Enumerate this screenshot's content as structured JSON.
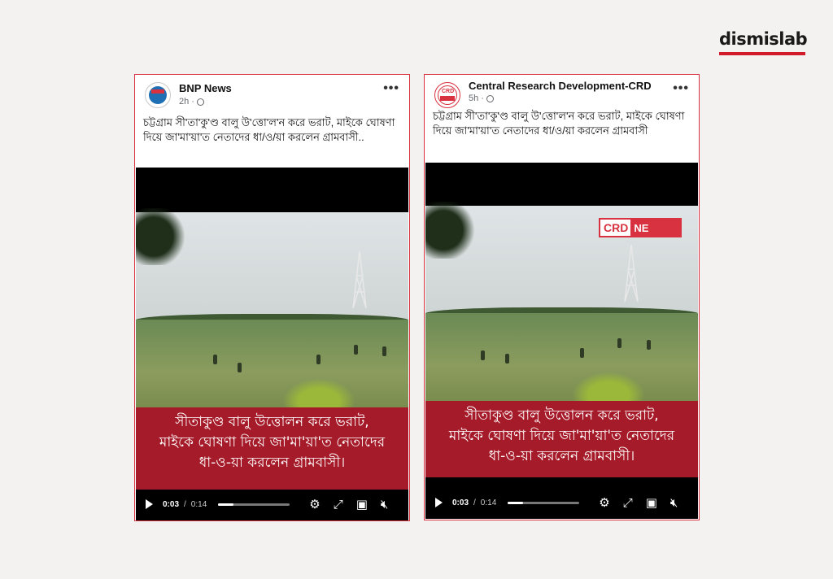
{
  "brand": {
    "name": "dismislab",
    "accent": "#d11a2a"
  },
  "posts": [
    {
      "page_name": "BNP News",
      "time": "2h",
      "meta_separator": "·",
      "more": "•••",
      "caption": "চট্টগ্রাম সী'তা'কু'ণ্ড বালু উ'ত্তো'ল'ন করে ভরাট, মাইকে ঘোষণা দিয়ে জা'মা'য়া'ত নেতাদের ধা/ও/য়া করলেন গ্রামবাসী..",
      "subtitle_lines": [
        "সীতাকুণ্ড বালু উত্তোলন করে ভরাট,",
        "মাইকে ঘোষণা দিয়ে জা'মা'য়া'ত নেতাদের",
        "ধা-ও-য়া করলেন গ্রামবাসী।"
      ],
      "time_current": "0:03",
      "time_sep": "/",
      "time_total": "0:14",
      "progress": 0.21
    },
    {
      "page_name": "Central Research Development-CRD",
      "time": "5h",
      "meta_separator": "·",
      "more": "•••",
      "avatar_text": "CRD",
      "caption": "চট্টগ্রাম সী'তা'কু'ণ্ড বালু উ'ত্তো'ল'ন করে ভরাট, মাইকে ঘোষণা দিয়ে জা'মা'য়া'ত নেতাদের ধা/ও/য়া করলেন গ্রামবাসী",
      "overlay_logo_a": "CRD",
      "overlay_logo_b": "NE",
      "subtitle_lines": [
        "সীতাকুণ্ড বালু উত্তোলন করে ভরাট,",
        "মাইকে ঘোষণা দিয়ে জা'মা'য়া'ত নেতাদের",
        "ধা-ও-য়া করলেন গ্রামবাসী।"
      ],
      "time_current": "0:03",
      "time_sep": "/",
      "time_total": "0:14",
      "progress": 0.21
    }
  ],
  "icons": [
    "play-icon",
    "settings-gear-icon",
    "fullscreen-expand-icon",
    "picture-in-picture-icon",
    "volume-muted-icon",
    "globe-icon",
    "more-options-icon"
  ],
  "colors": {
    "frame": "#d8313f",
    "subtitle_bg": "#a61b29"
  }
}
